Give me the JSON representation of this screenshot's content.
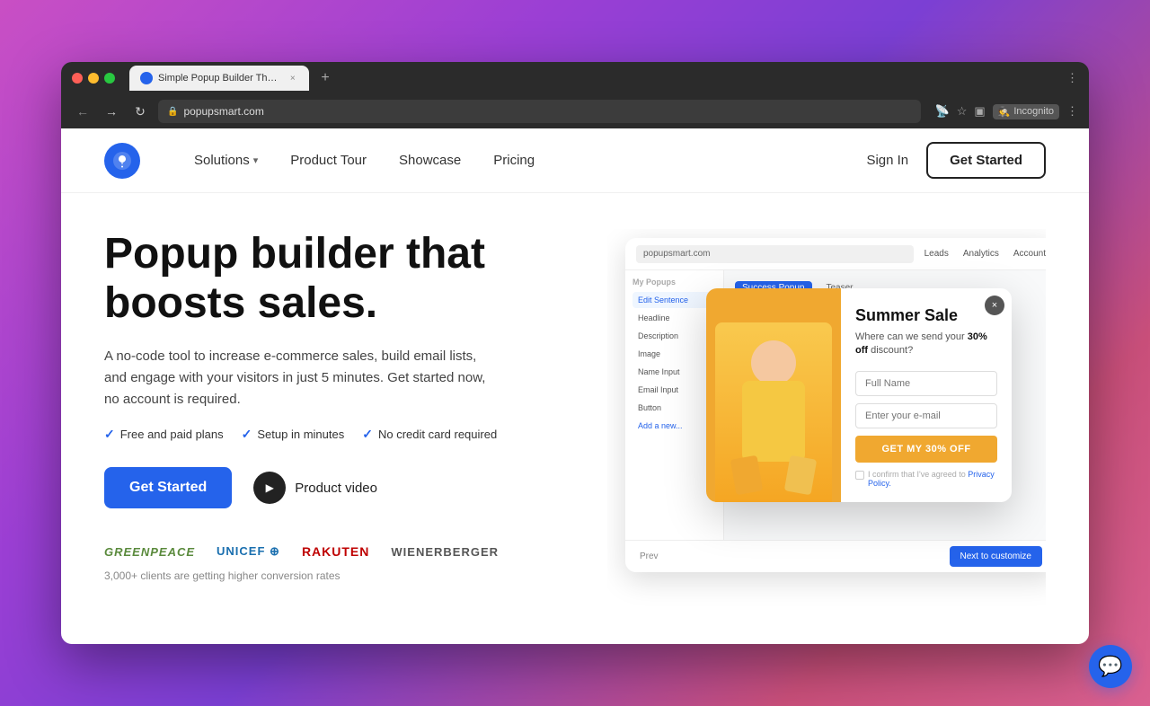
{
  "browser": {
    "tab_title": "Simple Popup Builder That Bo...",
    "url": "popupsmart.com",
    "tab_label_new": "+",
    "incognito_label": "Incognito"
  },
  "nav": {
    "logo_alt": "Popupsmart logo",
    "solutions_label": "Solutions",
    "product_tour_label": "Product Tour",
    "showcase_label": "Showcase",
    "pricing_label": "Pricing",
    "sign_in_label": "Sign In",
    "get_started_label": "Get Started"
  },
  "hero": {
    "title": "Popup builder that boosts sales.",
    "description": "A no-code tool to increase e-commerce sales, build email lists, and engage with your visitors in just 5 minutes. Get started now, no account is required.",
    "check1": "Free and paid plans",
    "check2": "Setup in minutes",
    "check3": "No credit card required",
    "cta_primary": "Get Started",
    "cta_video": "Product video",
    "clients_text": "3,000+ clients are getting higher conversion rates"
  },
  "brands": [
    {
      "name": "GREENPEACE",
      "class": "greenpeace"
    },
    {
      "name": "unicef",
      "class": "unicef"
    },
    {
      "name": "Rakuten",
      "class": "rakuten"
    },
    {
      "name": "wienerberger",
      "class": "wienerberger"
    }
  ],
  "popup": {
    "title": "Summer Sale",
    "subtitle": "Where can we send your",
    "discount": "30% off",
    "subtitle2": "discount?",
    "input1_placeholder": "Full Name",
    "input2_placeholder": "Enter your e-mail",
    "cta_label": "GET MY 30% OFF",
    "consent_text": "I confirm that I've agreed to Privacy Policy.",
    "close_icon": "×"
  },
  "dashboard": {
    "url_text": "popupsmart.com",
    "nav_items": [
      "Leads",
      "Analytics",
      "Account"
    ],
    "sidebar_items": [
      "My Popups",
      "Edit Sentence",
      "Headline",
      "Description",
      "Image",
      "Name Input",
      "Email Input",
      "Button",
      "Add a new..."
    ],
    "tabs": [
      "Success Popup",
      "Teaser"
    ]
  },
  "chat": {
    "icon": "💬"
  }
}
